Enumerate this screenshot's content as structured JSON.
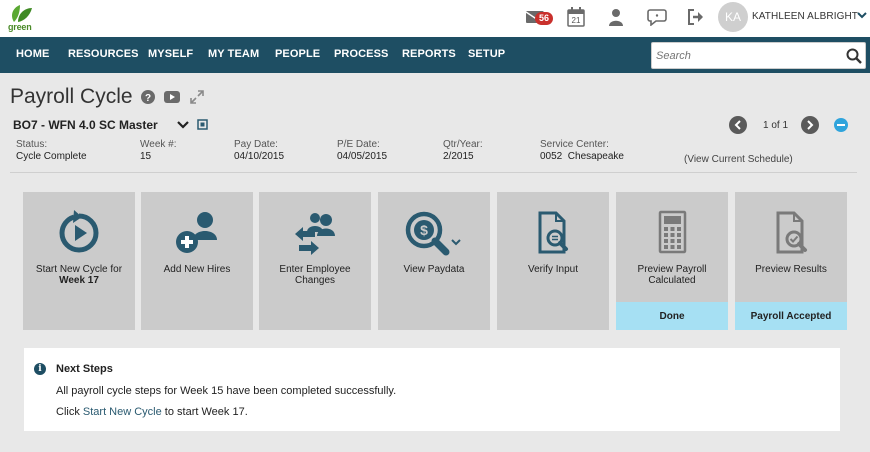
{
  "logo": {
    "text": "green"
  },
  "topbar": {
    "mail_count": "56",
    "calendar_day": "21",
    "user_initials": "KA",
    "user_name": "KATHLEEN ALBRIGHT"
  },
  "nav": {
    "items": [
      "HOME",
      "RESOURCES",
      "MYSELF",
      "MY TEAM",
      "PEOPLE",
      "PROCESS",
      "REPORTS",
      "SETUP"
    ]
  },
  "search": {
    "placeholder": "Search"
  },
  "page": {
    "title": "Payroll Cycle",
    "company": "BO7 - WFN 4.0 SC Master"
  },
  "pager": {
    "text": "1 of 1"
  },
  "info": {
    "status_label": "Status:",
    "status_value": "Cycle Complete",
    "week_label": "Week #:",
    "week_value": "15",
    "paydate_label": "Pay Date:",
    "paydate_value": "04/10/2015",
    "pedate_label": "P/E Date:",
    "pedate_value": "04/05/2015",
    "qtr_label": "Qtr/Year:",
    "qtr_value": "2/2015",
    "sc_label": "Service Center:",
    "sc_value": "0052  Chesapeake",
    "schedule_link": "(View Current Schedule)"
  },
  "tiles": {
    "start_line1": "Start New Cycle for",
    "start_line2": "Week 17",
    "add_hires": "Add New Hires",
    "enter_changes_1": "Enter Employee",
    "enter_changes_2": "Changes",
    "view_paydata": "View Paydata",
    "verify_input": "Verify Input",
    "preview_calc_1": "Preview Payroll",
    "preview_calc_2": "Calculated",
    "preview_calc_status": "Done",
    "preview_results": "Preview Results",
    "preview_results_status": "Payroll Accepted"
  },
  "next_steps": {
    "title": "Next Steps",
    "line1": "All payroll cycle steps for Week 15 have been completed successfully.",
    "line2_prefix": "Click ",
    "line2_link": "Start New Cycle",
    "line2_suffix": " to start Week 17."
  },
  "colors": {
    "nav_bg": "#1e4e63",
    "tile_bg": "#cbcbcb",
    "status_bg": "#a6e0f3",
    "icon_teal": "#2a5a70",
    "accent_blue": "#2fa4dc"
  }
}
